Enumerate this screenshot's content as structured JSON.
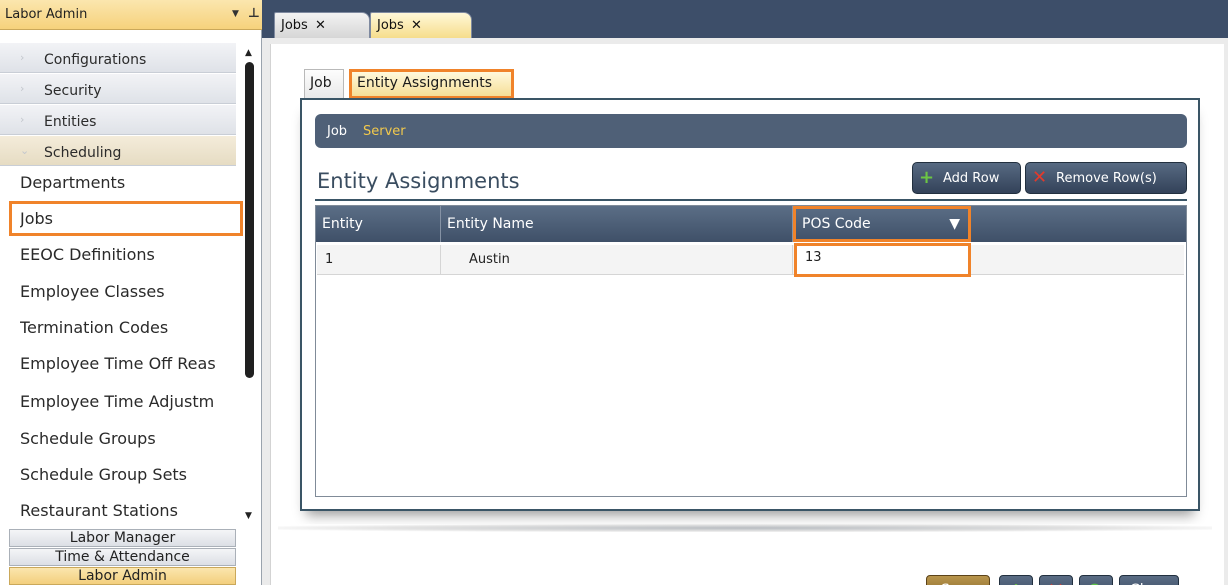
{
  "sidebar": {
    "title": "Labor Admin",
    "dropdown_glyph": "▼",
    "pin_glyph": "ꟼ",
    "groups": [
      {
        "label": "Configurations",
        "expanded": false
      },
      {
        "label": "Security",
        "expanded": false
      },
      {
        "label": "Entities",
        "expanded": false
      },
      {
        "label": "Scheduling",
        "expanded": true
      }
    ],
    "items": [
      {
        "label": "Departments",
        "selected": false
      },
      {
        "label": "Jobs",
        "selected": true
      },
      {
        "label": "EEOC Definitions",
        "selected": false
      },
      {
        "label": "Employee Classes",
        "selected": false
      },
      {
        "label": "Termination Codes",
        "selected": false
      },
      {
        "label": "Employee Time Off Reas",
        "selected": false
      },
      {
        "label": "Employee Time Adjustm",
        "selected": false
      },
      {
        "label": "Schedule Groups",
        "selected": false
      },
      {
        "label": "Schedule Group Sets",
        "selected": false
      },
      {
        "label": "Restaurant Stations",
        "selected": false
      }
    ],
    "modules": [
      {
        "label": "Labor Manager",
        "active": false
      },
      {
        "label": "Time & Attendance",
        "active": false
      },
      {
        "label": "Labor Admin",
        "active": true
      }
    ]
  },
  "doc_tabs": [
    {
      "label": "Jobs",
      "close_glyph": "✕",
      "active": false
    },
    {
      "label": "Jobs",
      "close_glyph": "✕",
      "active": true
    }
  ],
  "sub_tabs": [
    {
      "label": "Job",
      "active": false
    },
    {
      "label": "Entity Assignments",
      "active": true
    }
  ],
  "job_bar": {
    "key": "Job",
    "value": "Server"
  },
  "section": {
    "title": "Entity Assignments",
    "add_row_label": "Add Row",
    "remove_row_label": "Remove Row(s)"
  },
  "grid": {
    "columns": [
      "Entity",
      "Entity Name",
      "POS Code"
    ],
    "rows": [
      {
        "entity": "1",
        "entity_name": "Austin",
        "pos_code": "13"
      }
    ]
  },
  "footer": {
    "save_label": "Save",
    "close_label": "Close"
  },
  "colors": {
    "highlight": "#f0832a",
    "header_bg": "#3d4e69",
    "accent_gold": "#f6d27c",
    "job_value": "#f2c94c"
  }
}
